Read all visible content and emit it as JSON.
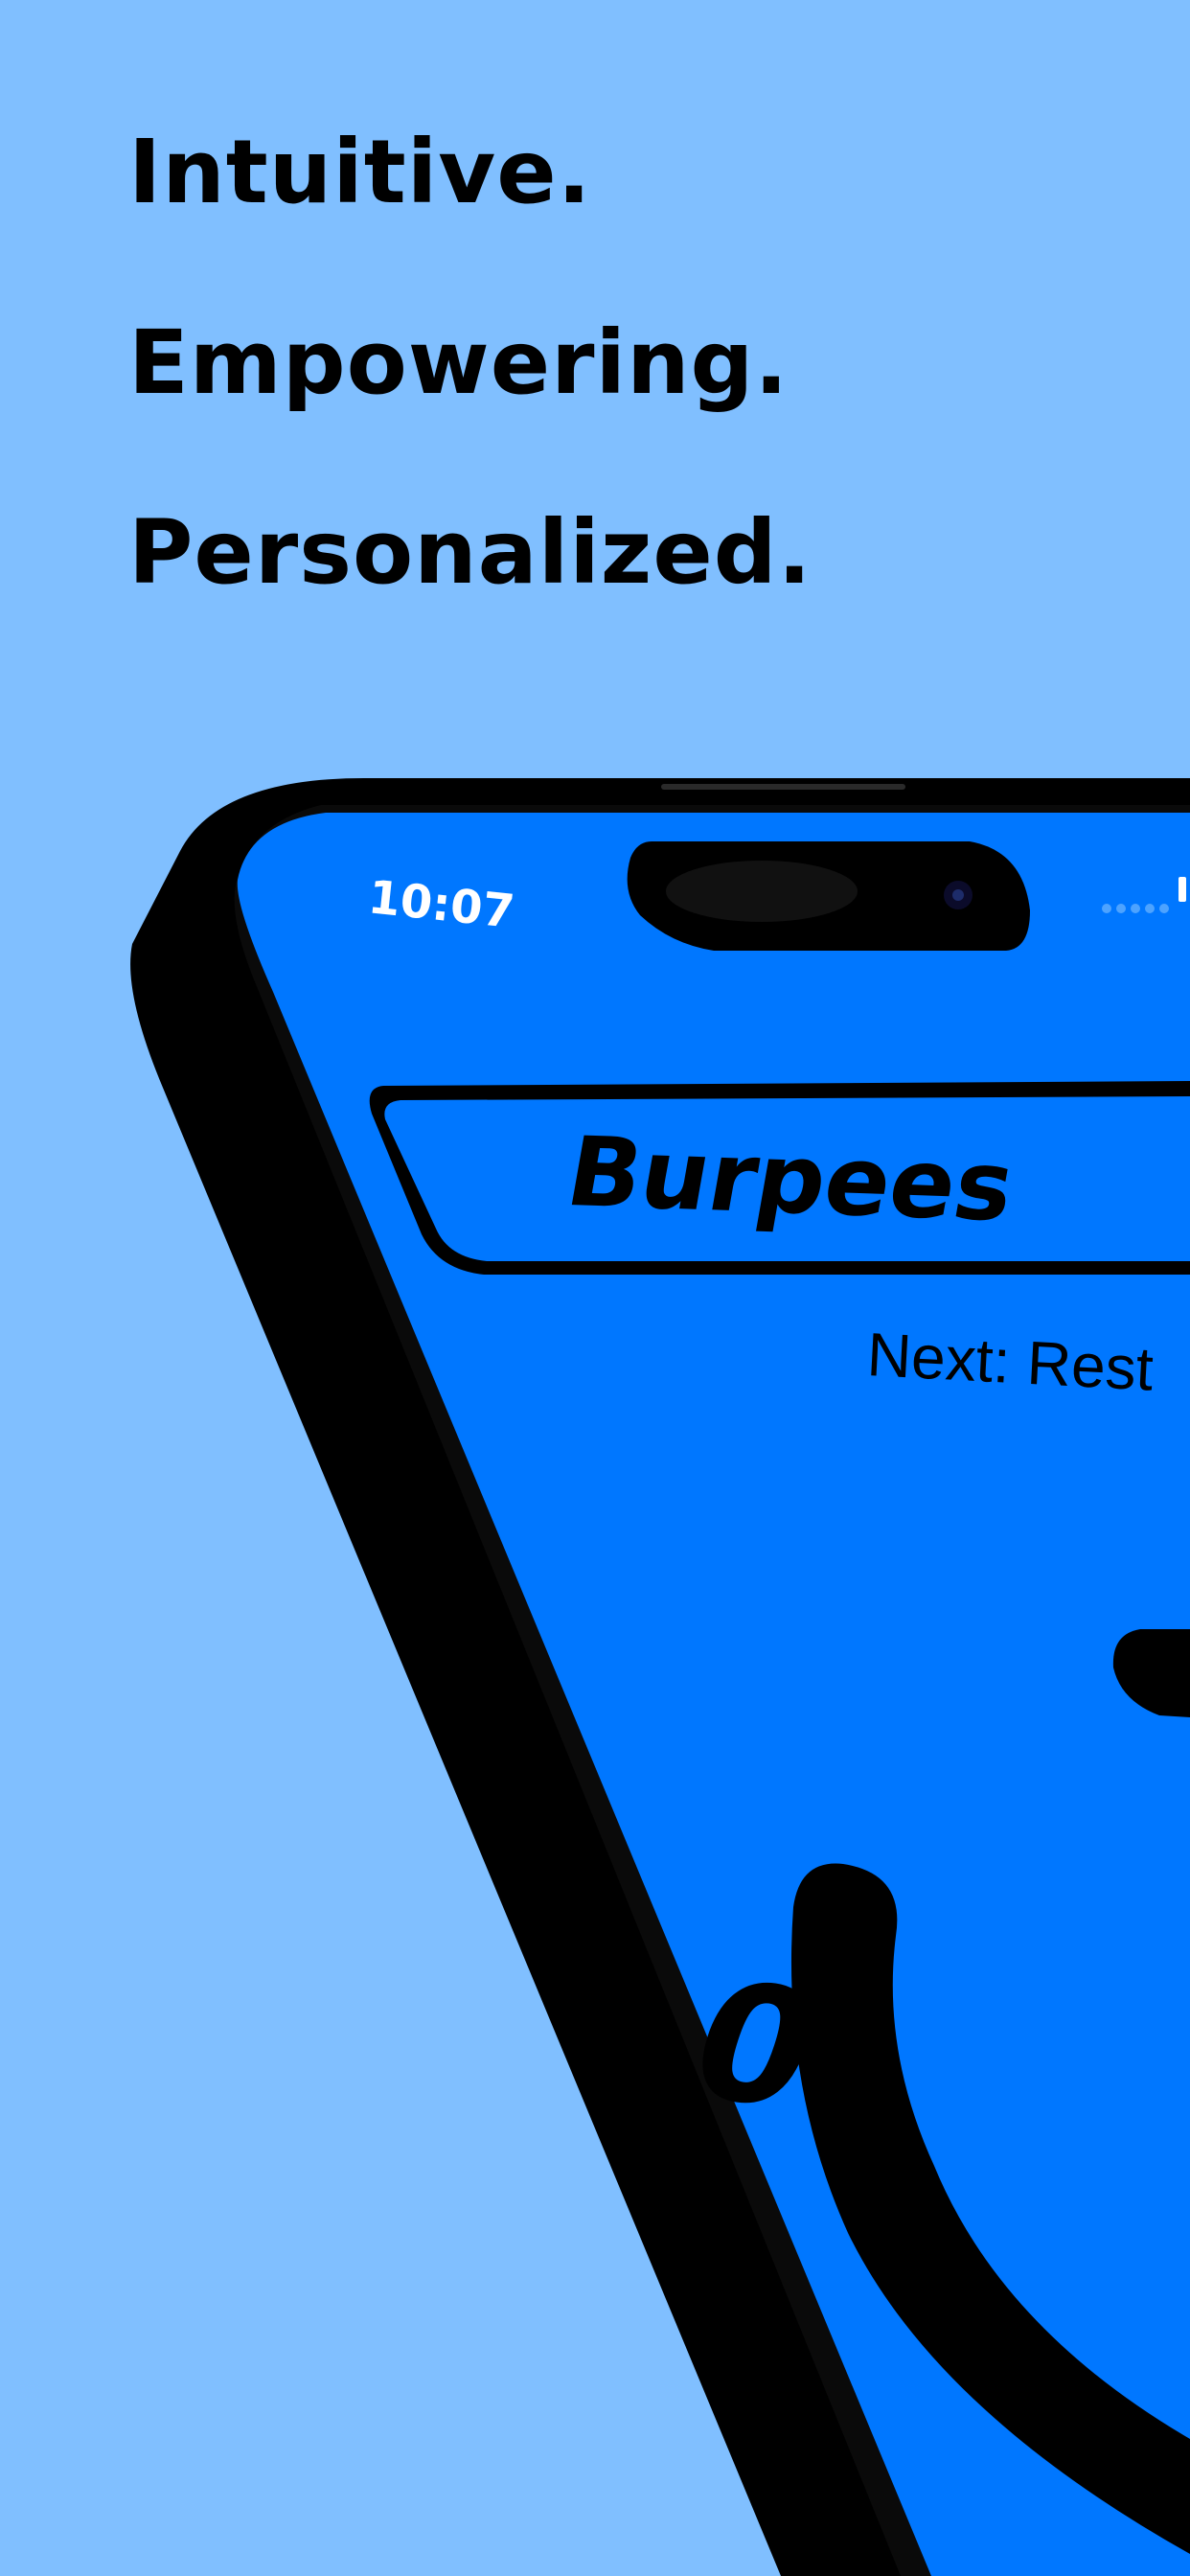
{
  "headlines": {
    "line1": "Intuitive.",
    "line2": "Empowering.",
    "line3": "Personalized."
  },
  "device": {
    "status_time": "10:07"
  },
  "workout": {
    "exercise_name": "Burpees",
    "next_label": "Next: Rest",
    "timer_partial": "0"
  },
  "colors": {
    "background": "#80bfff",
    "screen": "#0077ff",
    "frame": "#000000",
    "text": "#000000"
  }
}
